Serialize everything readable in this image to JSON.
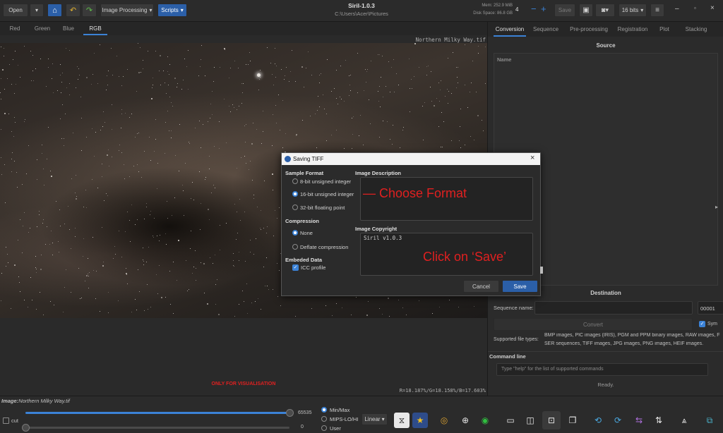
{
  "window": {
    "title": "Siril-1.0.3",
    "path": "C:\\Users\\Acer\\Pictures"
  },
  "toolbar": {
    "open_label": "Open",
    "image_processing_label": "Image Processing",
    "scripts_label": "Scripts",
    "mem_label": "Mem: 252.9 MiB",
    "disk_label": "Disk Space: 86.8 GB",
    "threads_value": "4",
    "save_label": "Save",
    "bits_label": "16 bits"
  },
  "channel_tabs": [
    "Red",
    "Green",
    "Blue",
    "RGB"
  ],
  "image": {
    "filename_overlay": "Northern Milky Way.tif",
    "visualisation_note": "ONLY FOR VISUALISATION",
    "stats_overlay": "R=18.187%/G=18.158%/B=17.603%"
  },
  "right_panel": {
    "tabs": [
      "Conversion",
      "Sequence",
      "Pre-processing",
      "Registration",
      "Plot",
      "Stacking"
    ],
    "source_title": "Source",
    "name_column": "Name",
    "destination_title": "Destination",
    "sequence_name_label": "Sequence name:",
    "sequence_start_value": "00001",
    "convert_label": "Convert",
    "symlink_label": "Sym",
    "supported_types_label": "Supported file types:",
    "supported_types_line1": "BMP images, PIC images (IRIS), PGM and PPM binary images, RAW images, F",
    "supported_types_line2": "SER sequences, TIFF images, JPG images, PNG images, HEIF images.",
    "command_line_title": "Command line",
    "command_placeholder": "Type \"help\" for the list of supported commands",
    "status_text": "Ready."
  },
  "bottom": {
    "image_label": "Image:",
    "image_name": "Northern Milky Way.tif",
    "cut_label": "cut",
    "max_value": "65535",
    "min_value": "0",
    "modes": [
      "Min/Max",
      "MIPS-LO/HI",
      "User"
    ],
    "selected_mode": "Min/Max",
    "stretch_label": "Linear"
  },
  "dialog": {
    "title": "Saving TIFF",
    "sample_format_title": "Sample Format",
    "sample_formats": [
      "8-bit unsigned integer",
      "16-bit unsigned integer",
      "32-bit floating point"
    ],
    "selected_format": "16-bit unsigned integer",
    "compression_title": "Compression",
    "compressions": [
      "None",
      "Deflate compression"
    ],
    "selected_compression": "None",
    "embedded_title": "Embeded Data",
    "icc_label": "ICC profile",
    "icc_checked": true,
    "description_title": "Image Description",
    "description_value": "",
    "copyright_title": "Image Copyright",
    "copyright_value": "Siril v1.0.3",
    "cancel_label": "Cancel",
    "save_label": "Save"
  },
  "annotations": {
    "choose_format": "— Choose Format",
    "click_save": "Click on ‘Save’"
  },
  "colors": {
    "accent": "#2b5fa8",
    "annotation": "#e02020"
  }
}
